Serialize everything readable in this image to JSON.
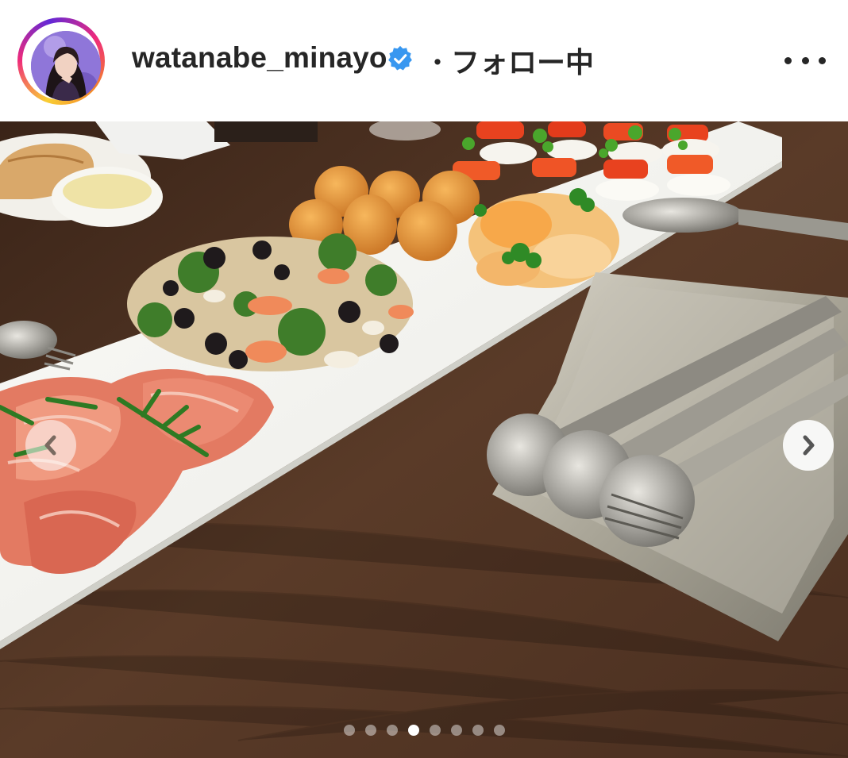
{
  "post": {
    "username": "watanabe_minayo",
    "separator": "・",
    "follow_status": "フォロー中",
    "verified": true,
    "avatar_icon": "profile-avatar",
    "more_icon": "more-options-icon"
  },
  "carousel": {
    "slide_count": 8,
    "active_index": 3,
    "prev_icon": "chevron-left-icon",
    "next_icon": "chevron-right-icon"
  },
  "colors": {
    "text": "#262626",
    "verified_badge": "#3897f0"
  }
}
